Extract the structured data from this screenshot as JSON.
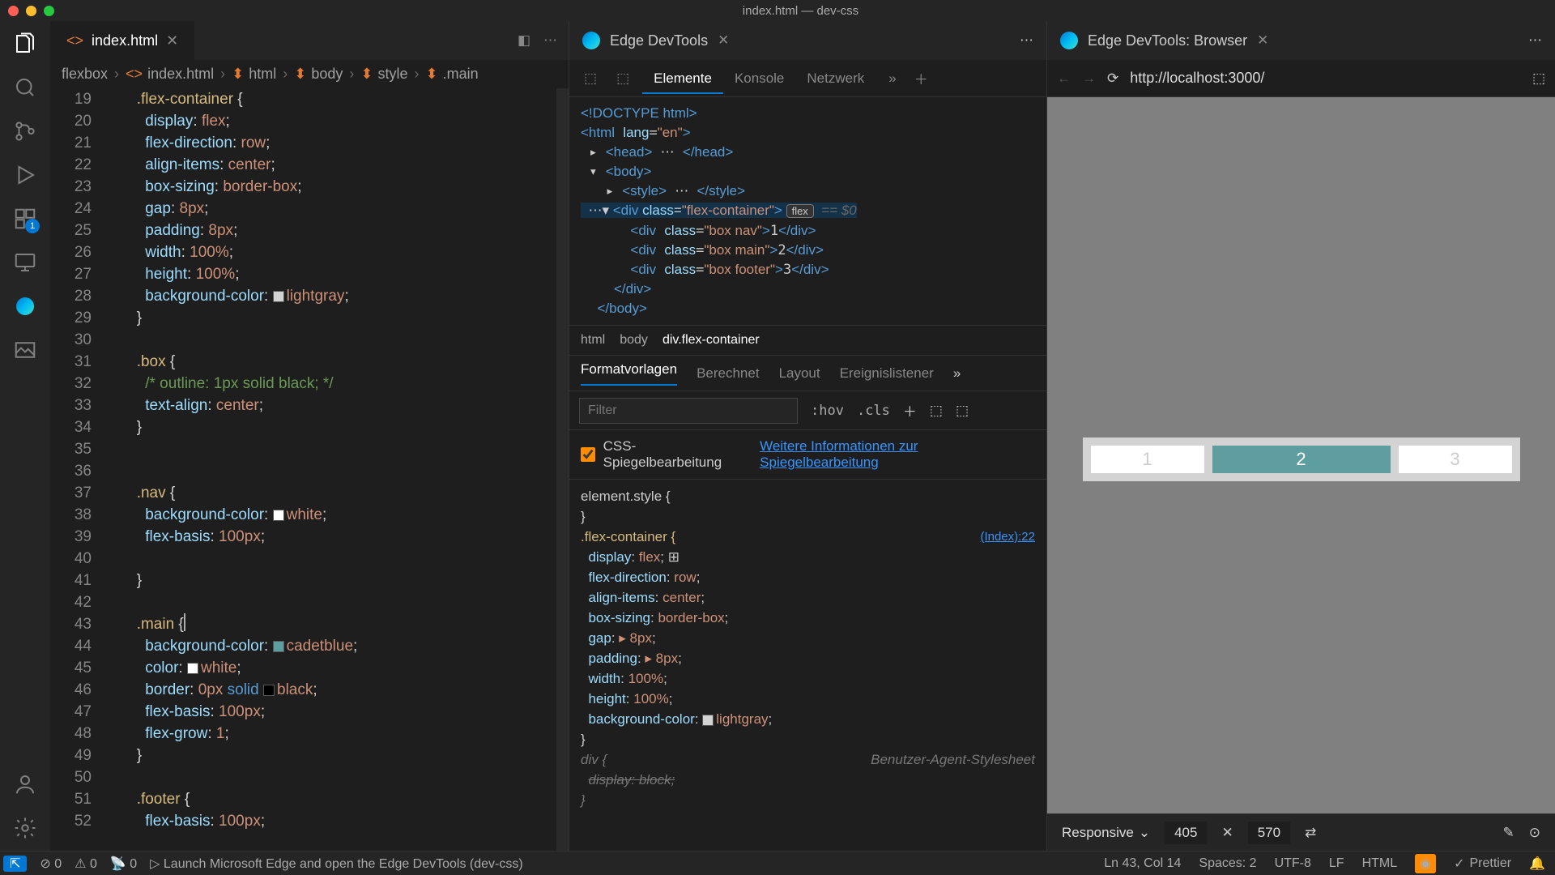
{
  "window_title": "index.html — dev-css",
  "activity_badge": "1",
  "editor_tab": {
    "filename": "index.html"
  },
  "breadcrumb": [
    "flexbox",
    "index.html",
    "html",
    "body",
    "style",
    ".main"
  ],
  "code_lines": [
    {
      "n": 19,
      "indent": 3,
      "sel": ".flex-container",
      "post": " {"
    },
    {
      "n": 20,
      "indent": 4,
      "prop": "display",
      "val": "flex"
    },
    {
      "n": 21,
      "indent": 4,
      "prop": "flex-direction",
      "val": "row"
    },
    {
      "n": 22,
      "indent": 4,
      "prop": "align-items",
      "val": "center"
    },
    {
      "n": 23,
      "indent": 4,
      "prop": "box-sizing",
      "val": "border-box"
    },
    {
      "n": 24,
      "indent": 4,
      "prop": "gap",
      "val": "8px"
    },
    {
      "n": 25,
      "indent": 4,
      "prop": "padding",
      "val": "8px"
    },
    {
      "n": 26,
      "indent": 4,
      "prop": "width",
      "val": "100%"
    },
    {
      "n": 27,
      "indent": 4,
      "prop": "height",
      "val": "100%"
    },
    {
      "n": 28,
      "indent": 4,
      "prop": "background-color",
      "sw": "#d3d3d3",
      "val": "lightgray"
    },
    {
      "n": 29,
      "indent": 3,
      "close": "}"
    },
    {
      "n": 30,
      "indent": 0,
      "blank": true
    },
    {
      "n": 31,
      "indent": 3,
      "sel": ".box",
      "post": " {"
    },
    {
      "n": 32,
      "indent": 4,
      "com": "/* outline: 1px solid black; */"
    },
    {
      "n": 33,
      "indent": 4,
      "prop": "text-align",
      "val": "center"
    },
    {
      "n": 34,
      "indent": 3,
      "close": "}"
    },
    {
      "n": 35,
      "indent": 0,
      "blank": true
    },
    {
      "n": 36,
      "indent": 0,
      "blank": true
    },
    {
      "n": 37,
      "indent": 3,
      "sel": ".nav",
      "post": " {"
    },
    {
      "n": 38,
      "indent": 4,
      "prop": "background-color",
      "sw": "#ffffff",
      "val": "white"
    },
    {
      "n": 39,
      "indent": 4,
      "prop": "flex-basis",
      "val": "100px"
    },
    {
      "n": 40,
      "indent": 0,
      "blank": true
    },
    {
      "n": 41,
      "indent": 3,
      "close": "}"
    },
    {
      "n": 42,
      "indent": 0,
      "blank": true
    },
    {
      "n": 43,
      "indent": 3,
      "sel": ".main",
      "post": " {",
      "cursor": true
    },
    {
      "n": 44,
      "indent": 4,
      "prop": "background-color",
      "sw": "#5f9ea0",
      "val": "cadetblue"
    },
    {
      "n": 45,
      "indent": 4,
      "prop": "color",
      "sw": "#ffffff",
      "val": "white"
    },
    {
      "n": 46,
      "indent": 4,
      "prop": "border",
      "raw": "<span class='tok-val'>0px</span> <span class='tok-key'>solid</span> <span class='swatch' style='background:#000'></span><span class='tok-val'>black</span>"
    },
    {
      "n": 47,
      "indent": 4,
      "prop": "flex-basis",
      "val": "100px"
    },
    {
      "n": 48,
      "indent": 4,
      "prop": "flex-grow",
      "val": "1"
    },
    {
      "n": 49,
      "indent": 3,
      "close": "}"
    },
    {
      "n": 50,
      "indent": 0,
      "blank": true
    },
    {
      "n": 51,
      "indent": 3,
      "sel": ".footer",
      "post": " {"
    },
    {
      "n": 52,
      "indent": 4,
      "prop": "flex-basis",
      "val": "100px"
    }
  ],
  "devtools": {
    "title": "Edge DevTools",
    "panels": [
      "Elemente",
      "Konsole",
      "Netzwerk"
    ],
    "active_panel": "Elemente",
    "dom_bc": [
      "html",
      "body",
      "div.flex-container"
    ],
    "style_tabs": [
      "Formatvorlagen",
      "Berechnet",
      "Layout",
      "Ereignislistener"
    ],
    "active_style_tab": "Formatvorlagen",
    "filter_placeholder": "Filter",
    "hov": ":hov",
    "cls": ".cls",
    "mirror_label": "CSS-Spiegelbearbeitung",
    "mirror_link": "Weitere Informationen zur Spiegelbearbeitung",
    "styles": {
      "element_style": "element.style {",
      "rule_selector": ".flex-container {",
      "rule_src": "(Index):22",
      "props": [
        {
          "p": "display",
          "v": "flex",
          "flexicon": true
        },
        {
          "p": "flex-direction",
          "v": "row"
        },
        {
          "p": "align-items",
          "v": "center"
        },
        {
          "p": "box-sizing",
          "v": "border-box"
        },
        {
          "p": "gap",
          "v": "▸ 8px"
        },
        {
          "p": "padding",
          "v": "▸ 8px"
        },
        {
          "p": "width",
          "v": "100%"
        },
        {
          "p": "height",
          "v": "100%"
        },
        {
          "p": "background-color",
          "v": "lightgray",
          "sw": "#d3d3d3"
        }
      ],
      "ua_label": "Benutzer-Agent-Stylesheet",
      "ua_sel": "div {",
      "ua_prop": "display: block;"
    }
  },
  "browser": {
    "title": "Edge DevTools: Browser",
    "url": "http://localhost:3000/",
    "boxes": [
      "1",
      "2",
      "3"
    ],
    "responsive": "Responsive",
    "w": "405",
    "h": "570"
  },
  "statusbar": {
    "errors": "0",
    "warnings": "0",
    "ports": "0",
    "launch": "Launch Microsoft Edge and open the Edge DevTools (dev-css)",
    "cursor": "Ln 43, Col 14",
    "spaces": "Spaces: 2",
    "enc": "UTF-8",
    "eol": "LF",
    "lang": "HTML",
    "prettier": "Prettier"
  }
}
